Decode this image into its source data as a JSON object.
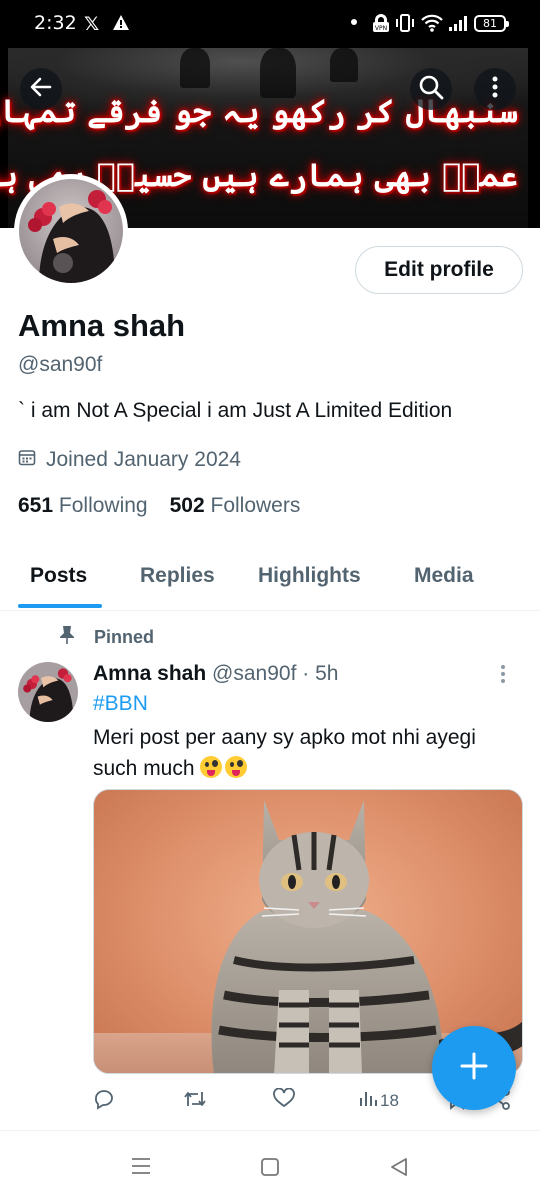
{
  "status_bar": {
    "time": "2:32",
    "x_glyph": "𝕏",
    "vpn_label": "VPN",
    "battery": "81",
    "icons": [
      "x-icon",
      "warning-icon",
      "vpn-icon",
      "vibrate-icon",
      "wifi-icon",
      "signal-icon",
      "battery-icon"
    ]
  },
  "banner": {
    "line1": "سنبھال کر رکھو یہ جو فرقے تمہارے ہیں",
    "line2": "عمرؓ بھی ہمارے ہیں حسینؑ بھی ہمارے ہیں"
  },
  "header_buttons": [
    "back-icon",
    "search-icon",
    "more-icon"
  ],
  "profile": {
    "edit_label": "Edit profile",
    "name": "Amna shah",
    "handle": "@san90f",
    "bio": "` i am Not A Special i am Just A Limited Edition",
    "joined": "Joined January 2024",
    "following_count": "651",
    "following_label": "Following",
    "followers_count": "502",
    "followers_label": "Followers"
  },
  "tabs": [
    {
      "label": "Posts",
      "active": true
    },
    {
      "label": "Replies",
      "active": false
    },
    {
      "label": "Highlights",
      "active": false
    },
    {
      "label": "Media",
      "active": false
    }
  ],
  "post": {
    "pinned_label": "Pinned",
    "author_name": "Amna shah",
    "meta": "@san90f · 5h",
    "hashtag": "#BBN",
    "text": "Meri post per aany sy apko mot nhi ayegi such much",
    "emojis": [
      "zany-face-emoji",
      "zany-face-emoji"
    ],
    "views": "18",
    "actions": [
      "reply-icon",
      "retweet-icon",
      "like-icon",
      "views-icon",
      "bookmark-icon",
      "share-icon"
    ]
  },
  "colors": {
    "accent": "#1d9bf0",
    "text": "#0f1419",
    "muted": "#536471",
    "border": "#cfd9de"
  },
  "navbar": [
    "menu-icon",
    "home-icon",
    "back-triangle-icon"
  ]
}
